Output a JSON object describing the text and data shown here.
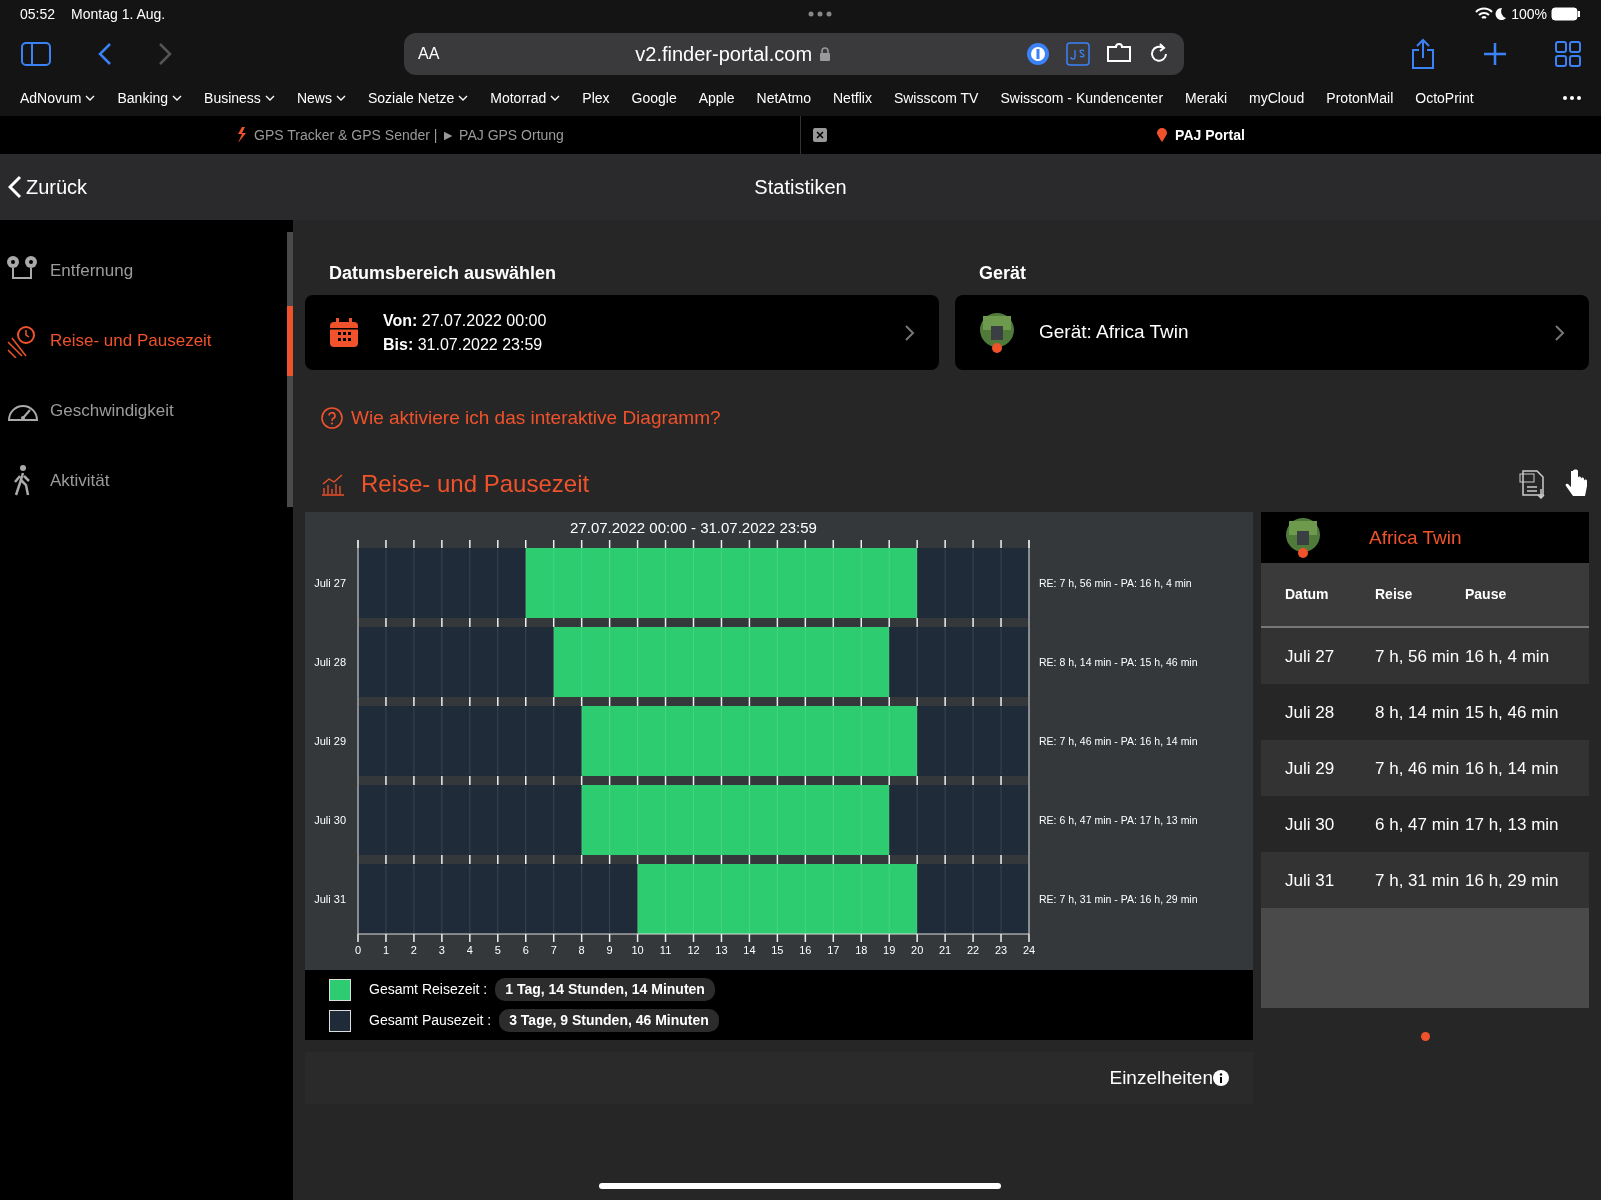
{
  "status_bar": {
    "time": "05:52",
    "date": "Montag 1. Aug.",
    "battery": "100%"
  },
  "browser": {
    "text_size": "AA",
    "address": "v2.finder-portal.com"
  },
  "bookmarks": [
    {
      "label": "AdNovum",
      "folder": true
    },
    {
      "label": "Banking",
      "folder": true
    },
    {
      "label": "Business",
      "folder": true
    },
    {
      "label": "News",
      "folder": true
    },
    {
      "label": "Soziale Netze",
      "folder": true
    },
    {
      "label": "Motorrad",
      "folder": true
    },
    {
      "label": "Plex",
      "folder": false
    },
    {
      "label": "Google",
      "folder": false
    },
    {
      "label": "Apple",
      "folder": false
    },
    {
      "label": "NetAtmo",
      "folder": false
    },
    {
      "label": "Netflix",
      "folder": false
    },
    {
      "label": "Swisscom TV",
      "folder": false
    },
    {
      "label": "Swisscom - Kundencenter",
      "folder": false
    },
    {
      "label": "Meraki",
      "folder": false
    },
    {
      "label": "myCloud",
      "folder": false
    },
    {
      "label": "ProtonMail",
      "folder": false
    },
    {
      "label": "OctoPrint",
      "folder": false
    }
  ],
  "tabs": [
    {
      "title": "GPS Tracker & GPS Sender | ► PAJ GPS Ortung",
      "selected": false
    },
    {
      "title": "PAJ Portal",
      "selected": true
    }
  ],
  "app": {
    "back": "Zurück",
    "title": "Statistiken"
  },
  "sidebar": {
    "items": [
      {
        "label": "Entfernung",
        "selected": false
      },
      {
        "label": "Reise- und Pausezeit",
        "selected": true
      },
      {
        "label": "Geschwindigkeit",
        "selected": false
      },
      {
        "label": "Aktivität",
        "selected": false
      }
    ]
  },
  "date_range": {
    "heading": "Datumsbereich auswählen",
    "from_label": "Von:",
    "from": "27.07.2022 00:00",
    "to_label": "Bis:",
    "to": "31.07.2022 23:59"
  },
  "device": {
    "heading": "Gerät",
    "label": "Gerät: Africa Twin"
  },
  "help_link": "Wie aktiviere ich das interaktive Diagramm?",
  "chart_section": {
    "title": "Reise- und Pausezeit",
    "chart_data": {
      "type": "bar",
      "orientation": "horizontal",
      "stacked": true,
      "title": "27.07.2022  00:00  - 31.07.2022  23:59",
      "categories": [
        "Juli 27",
        "Juli 28",
        "Juli 29",
        "Juli 30",
        "Juli 31"
      ],
      "series": [
        {
          "color": "#1f2b39",
          "values": [
            6,
            7,
            8,
            8,
            10
          ]
        },
        {
          "color": "#2ecc71",
          "values": [
            14,
            12,
            12,
            11,
            10
          ]
        },
        {
          "color": "#1f2b39",
          "values": [
            4,
            5,
            4,
            5,
            4
          ]
        }
      ],
      "grid": true,
      "xlim": [
        0,
        24
      ],
      "xticks": [
        0,
        1,
        2,
        3,
        4,
        5,
        6,
        7,
        8,
        9,
        10,
        11,
        12,
        13,
        14,
        15,
        16,
        17,
        18,
        19,
        20,
        21,
        22,
        23,
        24
      ],
      "annotations": [
        "RE: 7 h, 56 min - PA: 16 h, 4 min",
        "RE: 8 h, 14 min - PA: 15 h, 46 min",
        "RE: 7 h, 46 min - PA: 16 h, 14 min",
        "RE: 6 h, 47 min - PA: 17 h, 13 min",
        "RE: 7 h, 31 min - PA: 16 h, 29 min"
      ]
    },
    "legend": [
      {
        "label": "Gesamt Reisezeit :",
        "value": "1 Tag, 14 Stunden, 14 Minuten",
        "color": "#2ecc71"
      },
      {
        "label": "Gesamt Pausezeit :",
        "value": "3 Tage, 9 Stunden, 46 Minuten",
        "color": "#1f2b39"
      }
    ],
    "details_link": "Einzelheiten"
  },
  "table": {
    "device_name": "Africa Twin",
    "columns": [
      "Datum",
      "Reise",
      "Pause"
    ],
    "rows": [
      [
        "Juli 27",
        "7 h, 56 min",
        "16 h, 4 min"
      ],
      [
        "Juli 28",
        "8 h, 14 min",
        "15 h, 46 min"
      ],
      [
        "Juli 29",
        "7 h, 46 min",
        "16 h, 14 min"
      ],
      [
        "Juli 30",
        "6 h, 47 min",
        "17 h, 13 min"
      ],
      [
        "Juli 31",
        "7 h, 31 min",
        "16 h, 29 min"
      ]
    ]
  }
}
